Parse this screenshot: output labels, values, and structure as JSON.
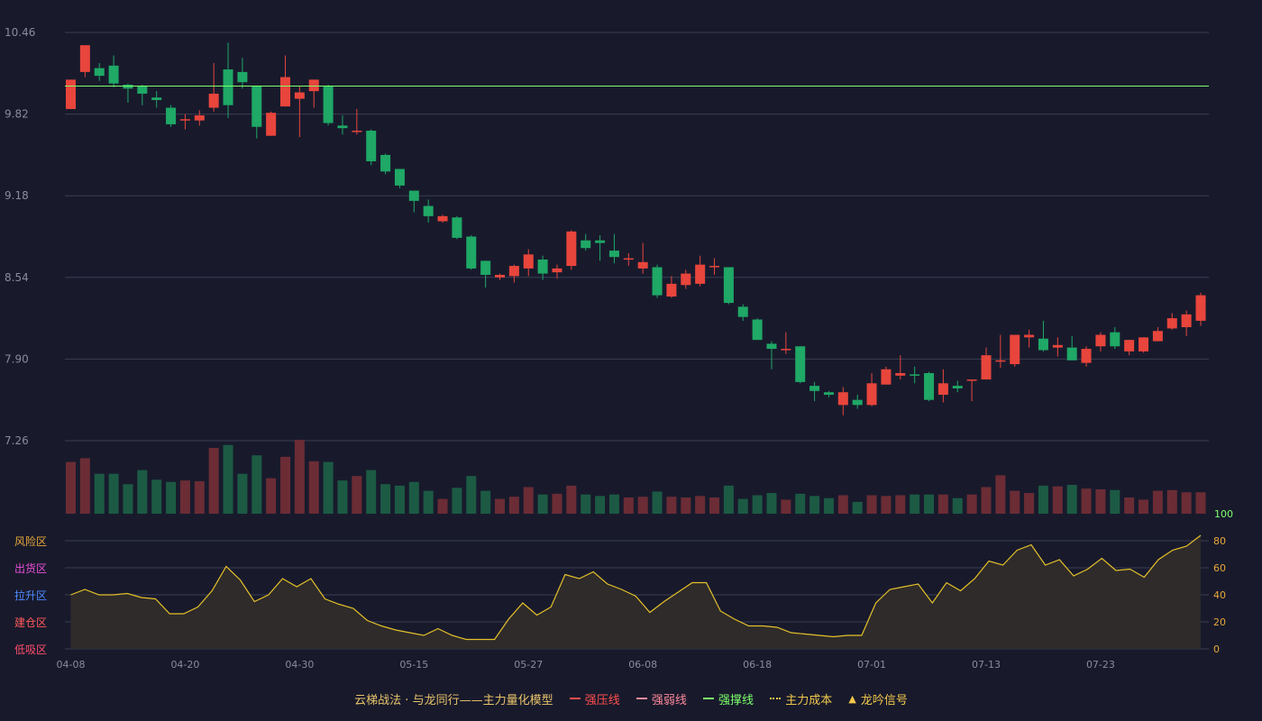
{
  "theme": {
    "background": "#181a2c",
    "grid": "#3a3d52",
    "axis_text": "#8a8c9c",
    "up": "#e8453c",
    "down": "#1fa866",
    "up_volume": "#6b2c35",
    "down_volume": "#1c5a44",
    "level_line": "#7dff6a",
    "osc_line": "#e4c02a",
    "osc_fill": "#2f2b2a"
  },
  "legend": {
    "title": "云梯战法 · 与龙同行——主力量化模型",
    "items": [
      {
        "label": "强压线",
        "color": "#ff4d4d",
        "style": "solid"
      },
      {
        "label": "强弱线",
        "color": "#ff8a9a",
        "style": "dashed"
      },
      {
        "label": "强撑线",
        "color": "#7dff6a",
        "style": "solid"
      },
      {
        "label": "主力成本",
        "color": "#f2c84b",
        "style": "dotted"
      },
      {
        "label": "龙吟信号",
        "color": "#f2c84b",
        "style": "triangle"
      }
    ]
  },
  "zones": [
    {
      "label": "风险区",
      "color": "#e8a838"
    },
    {
      "label": "出货区",
      "color": "#e84dd8"
    },
    {
      "label": "拉升区",
      "color": "#4d8cff"
    },
    {
      "label": "建仓区",
      "color": "#ff5a5a"
    },
    {
      "label": "低吸区",
      "color": "#ff4d6a"
    }
  ],
  "chart_data": [
    {
      "type": "candlestick",
      "price_axis": {
        "ticks": [
          "10.46",
          "9.82",
          "9.18",
          "8.54",
          "7.90",
          "7.26"
        ],
        "range": [
          7.26,
          10.46
        ]
      },
      "support_line": 10.04,
      "x_labels": [
        "04-08",
        "04-20",
        "04-30",
        "05-15",
        "05-27",
        "06-08",
        "06-18",
        "07-01",
        "07-13",
        "07-23"
      ],
      "x_label_index": [
        0,
        8,
        16,
        24,
        32,
        40,
        48,
        56,
        64,
        72
      ],
      "ohlc": [
        [
          9.86,
          10.09,
          9.86,
          10.09
        ],
        [
          10.15,
          10.36,
          10.11,
          10.25
        ],
        [
          10.18,
          10.12,
          10.08,
          10.22
        ],
        [
          10.2,
          10.06,
          10.03,
          10.28
        ],
        [
          10.05,
          10.02,
          9.91,
          10.06
        ],
        [
          10.04,
          9.98,
          9.89,
          10.05
        ],
        [
          9.95,
          9.93,
          9.87,
          10.0
        ],
        [
          9.87,
          9.74,
          9.72,
          9.89
        ],
        [
          9.78,
          9.78,
          9.7,
          9.82
        ],
        [
          9.77,
          9.81,
          9.73,
          9.85
        ],
        [
          9.87,
          9.98,
          9.84,
          10.22
        ],
        [
          10.17,
          9.89,
          9.79,
          10.38
        ],
        [
          10.15,
          10.07,
          10.02,
          10.26
        ],
        [
          10.04,
          9.72,
          9.63,
          10.04
        ],
        [
          9.65,
          9.83,
          9.65,
          9.84
        ],
        [
          9.88,
          10.11,
          9.88,
          10.28
        ],
        [
          9.94,
          9.99,
          9.64,
          10.04
        ],
        [
          10.0,
          10.09,
          9.87,
          10.09
        ],
        [
          10.04,
          9.75,
          9.73,
          10.05
        ],
        [
          9.73,
          9.71,
          9.66,
          9.81
        ],
        [
          9.69,
          9.69,
          9.66,
          9.86
        ],
        [
          9.69,
          9.45,
          9.42,
          9.7
        ],
        [
          9.5,
          9.37,
          9.35,
          9.51
        ],
        [
          9.39,
          9.26,
          9.24,
          9.39
        ],
        [
          9.22,
          9.14,
          9.05,
          9.22
        ],
        [
          9.1,
          9.02,
          8.97,
          9.15
        ],
        [
          8.98,
          9.02,
          8.97,
          9.03
        ],
        [
          9.01,
          8.85,
          8.84,
          9.02
        ],
        [
          8.86,
          8.61,
          8.6,
          8.87
        ],
        [
          8.67,
          8.56,
          8.46,
          8.67
        ],
        [
          8.54,
          8.56,
          8.52,
          8.57
        ],
        [
          8.55,
          8.63,
          8.5,
          8.64
        ],
        [
          8.61,
          8.72,
          8.55,
          8.76
        ],
        [
          8.68,
          8.57,
          8.52,
          8.71
        ],
        [
          8.58,
          8.61,
          8.53,
          8.64
        ],
        [
          8.63,
          8.9,
          8.6,
          8.91
        ],
        [
          8.83,
          8.77,
          8.75,
          8.88
        ],
        [
          8.83,
          8.81,
          8.67,
          8.87
        ],
        [
          8.75,
          8.7,
          8.65,
          8.88
        ],
        [
          8.69,
          8.69,
          8.63,
          8.73
        ],
        [
          8.61,
          8.66,
          8.57,
          8.81
        ],
        [
          8.62,
          8.4,
          8.38,
          8.64
        ],
        [
          8.39,
          8.49,
          8.38,
          8.55
        ],
        [
          8.48,
          8.57,
          8.45,
          8.6
        ],
        [
          8.49,
          8.64,
          8.47,
          8.71
        ],
        [
          8.62,
          8.63,
          8.56,
          8.69
        ],
        [
          8.62,
          8.34,
          8.33,
          8.62
        ],
        [
          8.31,
          8.23,
          8.2,
          8.33
        ],
        [
          8.21,
          8.05,
          8.05,
          8.22
        ],
        [
          8.02,
          7.98,
          7.82,
          8.04
        ],
        [
          7.98,
          7.98,
          7.94,
          8.11
        ],
        [
          8.0,
          7.72,
          7.71,
          8.0
        ],
        [
          7.69,
          7.65,
          7.57,
          7.72
        ],
        [
          7.64,
          7.62,
          7.6,
          7.65
        ],
        [
          7.54,
          7.64,
          7.46,
          7.68
        ],
        [
          7.58,
          7.54,
          7.51,
          7.62
        ],
        [
          7.54,
          7.71,
          7.53,
          7.79
        ],
        [
          7.7,
          7.82,
          7.7,
          7.84
        ],
        [
          7.77,
          7.79,
          7.74,
          7.93
        ],
        [
          7.78,
          7.77,
          7.71,
          7.84
        ],
        [
          7.79,
          7.58,
          7.57,
          7.8
        ],
        [
          7.62,
          7.71,
          7.56,
          7.82
        ],
        [
          7.69,
          7.67,
          7.64,
          7.73
        ],
        [
          7.73,
          7.74,
          7.57,
          7.74
        ],
        [
          7.74,
          7.93,
          7.74,
          7.99
        ],
        [
          7.89,
          7.89,
          7.83,
          8.09
        ],
        [
          7.86,
          8.09,
          7.84,
          8.09
        ],
        [
          8.07,
          8.09,
          7.99,
          8.13
        ],
        [
          8.06,
          7.97,
          7.96,
          8.2
        ],
        [
          7.99,
          8.01,
          7.92,
          8.07
        ],
        [
          7.99,
          7.89,
          7.89,
          8.08
        ],
        [
          7.87,
          7.98,
          7.84,
          8.0
        ],
        [
          8.0,
          8.09,
          7.96,
          8.11
        ],
        [
          8.11,
          8.0,
          7.98,
          8.15
        ],
        [
          7.96,
          8.05,
          7.93,
          8.05
        ],
        [
          7.96,
          8.07,
          7.95,
          8.07
        ],
        [
          8.04,
          8.12,
          8.04,
          8.15
        ],
        [
          8.14,
          8.22,
          8.13,
          8.26
        ],
        [
          8.15,
          8.25,
          8.08,
          8.28
        ],
        [
          8.2,
          8.4,
          8.16,
          8.42
        ]
      ],
      "volume": [
        0.7,
        0.75,
        0.54,
        0.54,
        0.4,
        0.59,
        0.46,
        0.43,
        0.45,
        0.44,
        0.89,
        0.93,
        0.54,
        0.79,
        0.48,
        0.77,
        1.0,
        0.71,
        0.7,
        0.45,
        0.51,
        0.59,
        0.4,
        0.38,
        0.43,
        0.31,
        0.2,
        0.35,
        0.51,
        0.31,
        0.2,
        0.23,
        0.36,
        0.26,
        0.27,
        0.38,
        0.26,
        0.24,
        0.26,
        0.22,
        0.23,
        0.3,
        0.23,
        0.22,
        0.24,
        0.22,
        0.38,
        0.2,
        0.25,
        0.28,
        0.19,
        0.27,
        0.24,
        0.21,
        0.25,
        0.16,
        0.25,
        0.24,
        0.25,
        0.26,
        0.26,
        0.26,
        0.21,
        0.26,
        0.36,
        0.52,
        0.31,
        0.28,
        0.38,
        0.37,
        0.39,
        0.34,
        0.33,
        0.32,
        0.22,
        0.19,
        0.31,
        0.32,
        0.29,
        0.29
      ],
      "volume_axis_label": "100"
    },
    {
      "type": "area",
      "y_ticks": [
        "80",
        "60",
        "40",
        "20",
        "0"
      ],
      "y_range": [
        0,
        100
      ],
      "values": [
        40,
        44,
        40,
        40,
        41,
        38,
        37,
        26,
        26,
        31,
        43,
        61,
        51,
        35,
        40,
        52,
        46,
        52,
        37,
        33,
        30,
        21,
        17,
        14,
        12,
        10,
        15,
        10,
        7,
        7,
        7,
        22,
        34,
        25,
        31,
        55,
        52,
        57,
        48,
        44,
        39,
        27,
        35,
        42,
        49,
        49,
        28,
        22,
        17,
        17,
        16,
        12,
        11,
        10,
        9,
        10,
        10,
        34,
        44,
        46,
        48,
        34,
        49,
        43,
        52,
        65,
        62,
        73,
        77,
        62,
        66,
        54,
        59,
        67,
        58,
        59,
        53,
        66,
        73,
        76,
        84
      ]
    }
  ]
}
